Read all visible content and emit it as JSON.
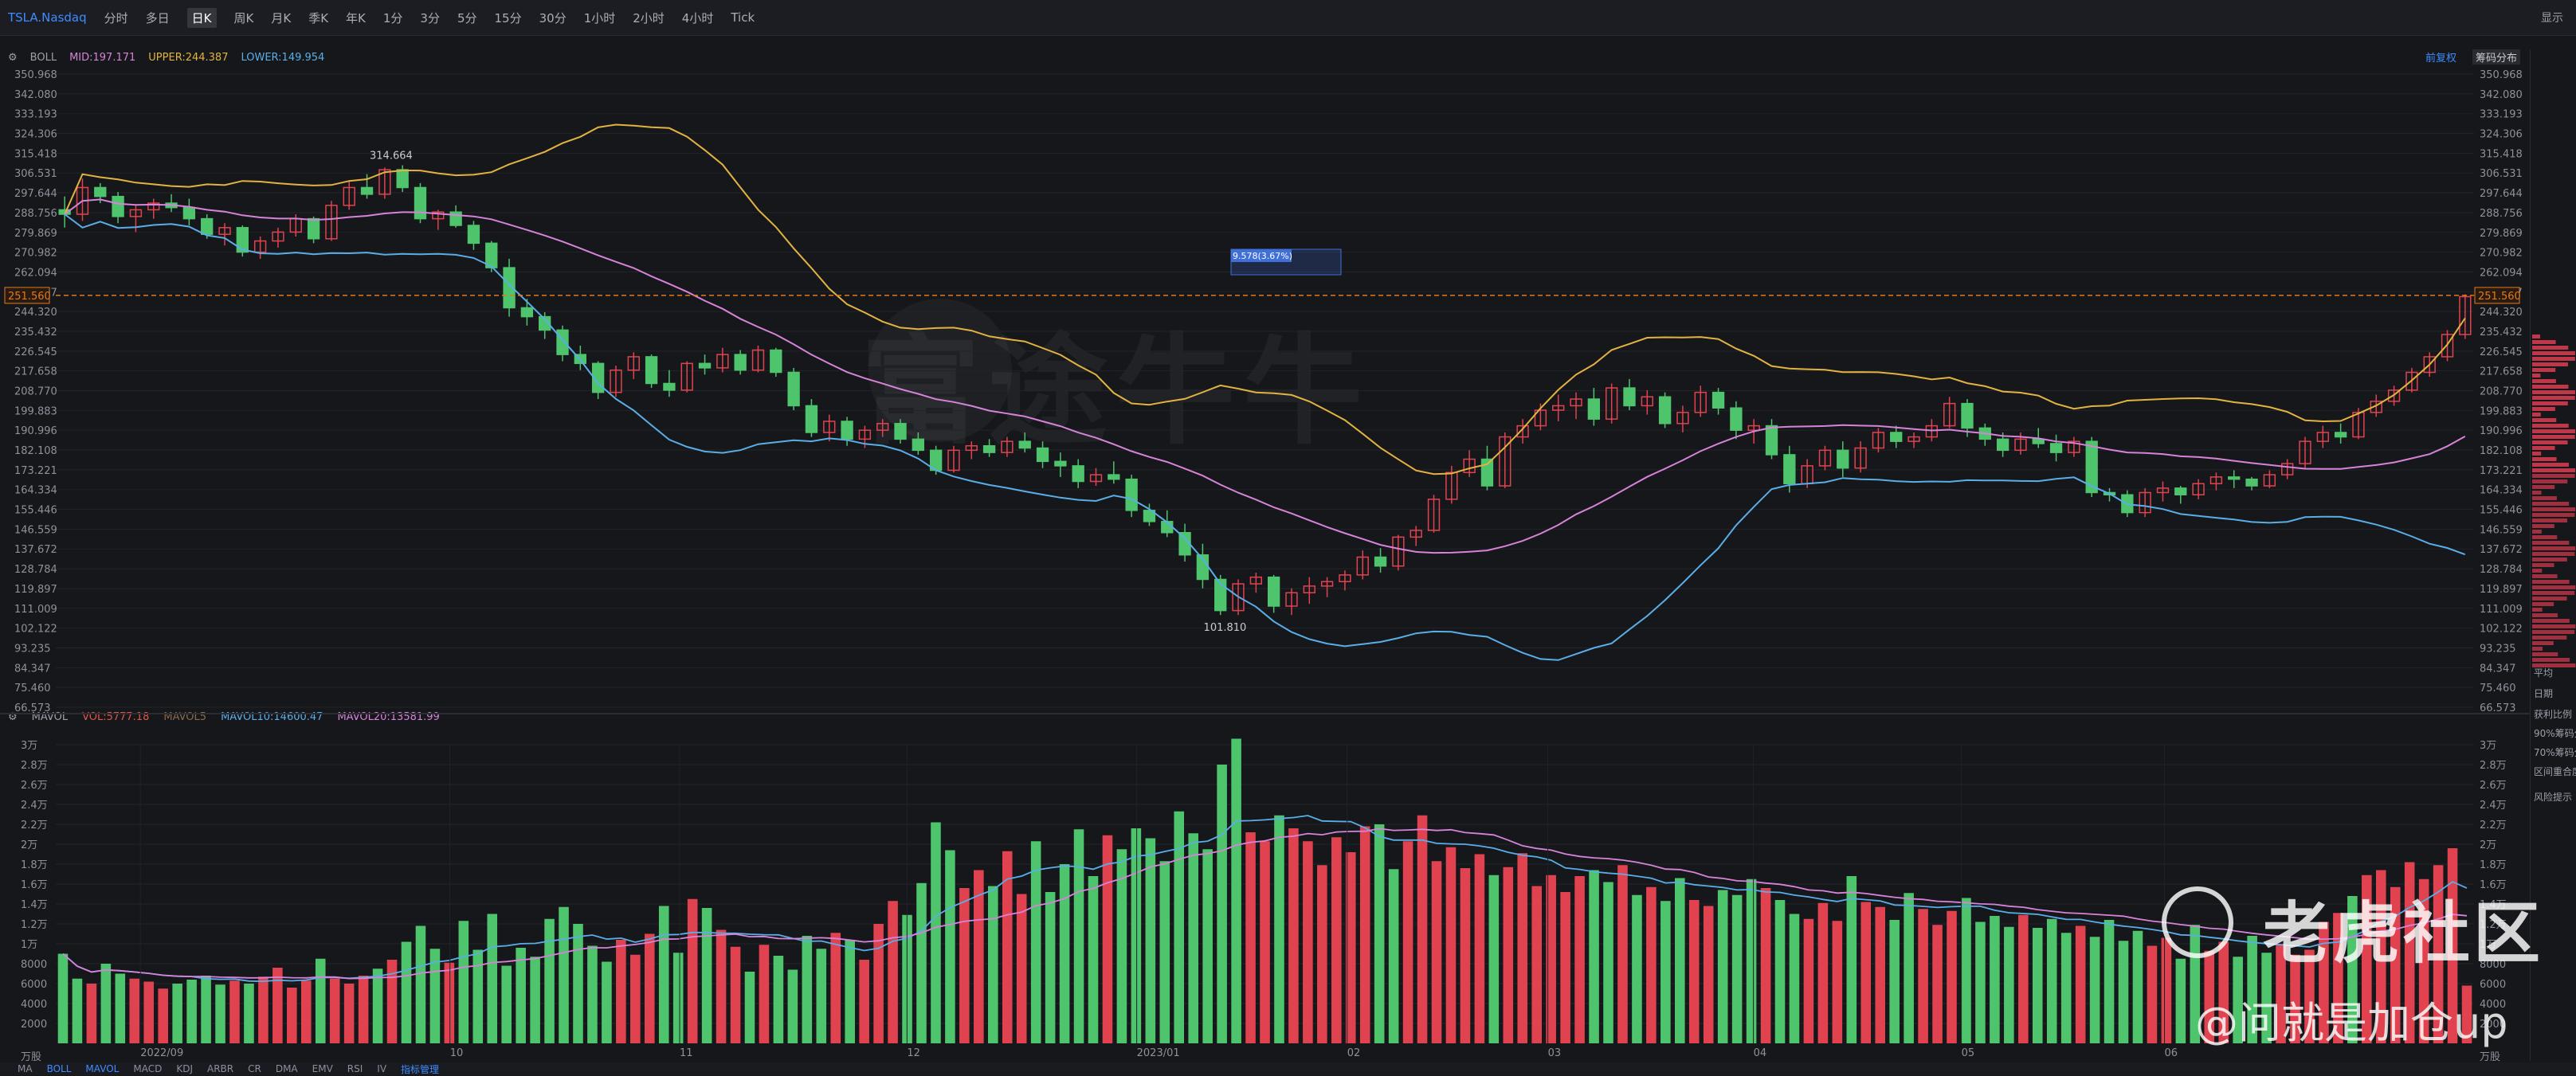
{
  "toolbar": {
    "symbol": "TSLA.Nasdaq",
    "timeframes": [
      "分时",
      "多日",
      "日K",
      "周K",
      "月K",
      "季K",
      "年K",
      "1分",
      "3分",
      "5分",
      "15分",
      "30分",
      "1小时",
      "2小时",
      "4小时",
      "Tick"
    ],
    "active_timeframe": "日K",
    "display_label": "显示"
  },
  "indicators": {
    "name": "BOLL",
    "mid": "MID:197.171",
    "upper": "UPPER:244.387",
    "lower": "LOWER:149.954",
    "adjust": "前复权",
    "chip": "筹码分布"
  },
  "volume_indicators": {
    "name": "MAVOL",
    "vol": "VOL:5777.18",
    "mavol5": "MAVOL5",
    "mavol10": "MAVOL10:14600.47",
    "mavol20": "MAVOL20:13581.99"
  },
  "colors": {
    "up": "#e0434f",
    "down": "#4ec46d",
    "mid": "#d683d9",
    "upper": "#e3b341",
    "lower": "#5aaee8",
    "bg": "#16171b",
    "last_price": "#e07a1f"
  },
  "price_axis_labels": [
    "350.968",
    "342.080",
    "333.193",
    "324.306",
    "315.418",
    "306.531",
    "297.644",
    "288.756",
    "279.869",
    "270.982",
    "262.094",
    "253.207",
    "244.320",
    "235.432",
    "226.545",
    "217.658",
    "208.770",
    "199.883",
    "190.996",
    "182.108",
    "173.221",
    "164.334",
    "155.446",
    "146.559",
    "137.672",
    "128.784",
    "119.897",
    "111.009",
    "102.122",
    "93.235",
    "84.347",
    "75.460",
    "66.573"
  ],
  "last_price_label": "251.560",
  "volume_axis_labels": [
    "3万",
    "2.8万",
    "2.6万",
    "2.4万",
    "2.2万",
    "2万",
    "1.8万",
    "1.6万",
    "1.4万",
    "1.2万",
    "1万",
    "8000",
    "6000",
    "4000",
    "2000",
    "万股"
  ],
  "date_labels": [
    "2022/09",
    "10",
    "11",
    "12",
    "2023/01",
    "02",
    "03",
    "04",
    "05",
    "06"
  ],
  "annotations": {
    "high": "314.664",
    "low": "101.810",
    "measure": "9.578(3.67%)"
  },
  "bottom_tabs": [
    "MA",
    "BOLL",
    "MAVOL",
    "MACD",
    "KDJ",
    "ARBR",
    "CR",
    "DMA",
    "EMV",
    "RSI",
    "IV",
    "指标管理"
  ],
  "side_panel": [
    "平均",
    "日期",
    "获利比例",
    "90%筹码分",
    "70%筹码分",
    "区间重合度",
    "风险提示"
  ],
  "watermarks": {
    "brand": "老虎社区",
    "user": "@问就是加仓up",
    "ghost": "富途牛牛"
  },
  "chart_data": {
    "type": "candlestick",
    "ylim": [
      66.573,
      350.968
    ],
    "volume_ylim": [
      0,
      30000
    ],
    "candles": [
      [
        290,
        296,
        282,
        288
      ],
      [
        288,
        304,
        285,
        300
      ],
      [
        300,
        302,
        293,
        296
      ],
      [
        296,
        298,
        284,
        287
      ],
      [
        287,
        292,
        280,
        290
      ],
      [
        290,
        295,
        286,
        293
      ],
      [
        293,
        297,
        289,
        291
      ],
      [
        291,
        295,
        283,
        286
      ],
      [
        286,
        288,
        277,
        279
      ],
      [
        279,
        284,
        274,
        282
      ],
      [
        282,
        283,
        269,
        271
      ],
      [
        271,
        278,
        268,
        276
      ],
      [
        276,
        282,
        273,
        280
      ],
      [
        280,
        288,
        278,
        286
      ],
      [
        286,
        287,
        275,
        277
      ],
      [
        277,
        294,
        276,
        292
      ],
      [
        292,
        303,
        290,
        300
      ],
      [
        300,
        306,
        295,
        297
      ],
      [
        297,
        309,
        295,
        308
      ],
      [
        308,
        310,
        298,
        300
      ],
      [
        300,
        302,
        284,
        286
      ],
      [
        286,
        290,
        281,
        289
      ],
      [
        289,
        292,
        282,
        283
      ],
      [
        283,
        285,
        272,
        275
      ],
      [
        275,
        276,
        262,
        264
      ],
      [
        264,
        268,
        242,
        246
      ],
      [
        246,
        250,
        238,
        242
      ],
      [
        242,
        244,
        232,
        236
      ],
      [
        236,
        238,
        222,
        225
      ],
      [
        225,
        229,
        218,
        221
      ],
      [
        221,
        222,
        205,
        208
      ],
      [
        208,
        220,
        206,
        218
      ],
      [
        218,
        226,
        214,
        224
      ],
      [
        224,
        225,
        210,
        212
      ],
      [
        212,
        218,
        206,
        209
      ],
      [
        209,
        222,
        208,
        221
      ],
      [
        221,
        225,
        216,
        219
      ],
      [
        219,
        228,
        217,
        225
      ],
      [
        225,
        227,
        216,
        218
      ],
      [
        218,
        229,
        217,
        227
      ],
      [
        227,
        228,
        215,
        217
      ],
      [
        217,
        219,
        200,
        202
      ],
      [
        202,
        205,
        188,
        190
      ],
      [
        190,
        198,
        186,
        195
      ],
      [
        195,
        197,
        184,
        187
      ],
      [
        187,
        193,
        183,
        191
      ],
      [
        191,
        196,
        188,
        194
      ],
      [
        194,
        196,
        185,
        187
      ],
      [
        187,
        190,
        180,
        182
      ],
      [
        182,
        184,
        171,
        173
      ],
      [
        173,
        184,
        172,
        182
      ],
      [
        182,
        186,
        178,
        184
      ],
      [
        184,
        187,
        179,
        181
      ],
      [
        181,
        188,
        179,
        186
      ],
      [
        186,
        190,
        181,
        183
      ],
      [
        183,
        186,
        174,
        177
      ],
      [
        177,
        181,
        170,
        175
      ],
      [
        175,
        178,
        165,
        168
      ],
      [
        168,
        174,
        166,
        171
      ],
      [
        171,
        177,
        167,
        169
      ],
      [
        169,
        171,
        152,
        155
      ],
      [
        155,
        158,
        148,
        150
      ],
      [
        150,
        155,
        143,
        145
      ],
      [
        145,
        149,
        132,
        135
      ],
      [
        135,
        140,
        120,
        124
      ],
      [
        124,
        126,
        108,
        110
      ],
      [
        110,
        124,
        108,
        122
      ],
      [
        122,
        127,
        118,
        125
      ],
      [
        125,
        126,
        109,
        112
      ],
      [
        112,
        120,
        108,
        118
      ],
      [
        118,
        125,
        113,
        121
      ],
      [
        121,
        125,
        116,
        123
      ],
      [
        123,
        128,
        119,
        126
      ],
      [
        126,
        137,
        124,
        134
      ],
      [
        134,
        138,
        127,
        130
      ],
      [
        130,
        144,
        128,
        143
      ],
      [
        143,
        148,
        139,
        146
      ],
      [
        146,
        162,
        145,
        160
      ],
      [
        160,
        175,
        158,
        172
      ],
      [
        172,
        182,
        170,
        178
      ],
      [
        178,
        184,
        164,
        166
      ],
      [
        166,
        190,
        165,
        188
      ],
      [
        188,
        196,
        185,
        193
      ],
      [
        193,
        203,
        191,
        200
      ],
      [
        200,
        207,
        195,
        202
      ],
      [
        202,
        208,
        196,
        205
      ],
      [
        205,
        210,
        193,
        196
      ],
      [
        196,
        212,
        194,
        210
      ],
      [
        210,
        214,
        200,
        202
      ],
      [
        202,
        209,
        198,
        206
      ],
      [
        206,
        208,
        192,
        194
      ],
      [
        194,
        202,
        190,
        199
      ],
      [
        199,
        211,
        197,
        208
      ],
      [
        208,
        210,
        198,
        201
      ],
      [
        201,
        204,
        187,
        191
      ],
      [
        191,
        196,
        185,
        193
      ],
      [
        193,
        196,
        178,
        180
      ],
      [
        180,
        184,
        163,
        167
      ],
      [
        167,
        178,
        165,
        175
      ],
      [
        175,
        184,
        173,
        182
      ],
      [
        182,
        186,
        170,
        174
      ],
      [
        174,
        186,
        172,
        183
      ],
      [
        183,
        192,
        181,
        190
      ],
      [
        190,
        193,
        183,
        186
      ],
      [
        186,
        190,
        183,
        188
      ],
      [
        188,
        196,
        186,
        193
      ],
      [
        193,
        206,
        192,
        203
      ],
      [
        203,
        205,
        188,
        192
      ],
      [
        192,
        194,
        184,
        187
      ],
      [
        187,
        190,
        179,
        182
      ],
      [
        182,
        190,
        180,
        187
      ],
      [
        187,
        192,
        183,
        185
      ],
      [
        185,
        189,
        177,
        181
      ],
      [
        181,
        188,
        179,
        186
      ],
      [
        186,
        188,
        161,
        163
      ],
      [
        163,
        165,
        159,
        162
      ],
      [
        162,
        164,
        152,
        154
      ],
      [
        154,
        165,
        152,
        163
      ],
      [
        163,
        168,
        159,
        165
      ],
      [
        165,
        166,
        158,
        162
      ],
      [
        162,
        169,
        160,
        167
      ],
      [
        167,
        172,
        164,
        170
      ],
      [
        170,
        173,
        165,
        169
      ],
      [
        169,
        170,
        164,
        166
      ],
      [
        166,
        173,
        165,
        171
      ],
      [
        171,
        178,
        169,
        176
      ],
      [
        176,
        188,
        174,
        186
      ],
      [
        186,
        193,
        183,
        190
      ],
      [
        190,
        194,
        185,
        188
      ],
      [
        188,
        201,
        187,
        199
      ],
      [
        199,
        207,
        197,
        204
      ],
      [
        204,
        211,
        202,
        209
      ],
      [
        209,
        219,
        208,
        217
      ],
      [
        217,
        226,
        215,
        224
      ],
      [
        224,
        236,
        222,
        234
      ],
      [
        234,
        252,
        232,
        251
      ]
    ],
    "volumes_k": [
      9,
      6.5,
      6,
      8,
      7,
      6.5,
      6.2,
      5.5,
      6,
      6.4,
      6.8,
      5.9,
      6.3,
      6,
      6.7,
      7.6,
      5.6,
      6.3,
      8.5,
      6.5,
      6,
      6.8,
      7.5,
      8.4,
      10.2,
      11.8,
      9.5,
      8.1,
      12.3,
      9.4,
      13,
      7.8,
      9.6,
      8.7,
      12.5,
      13.7,
      12,
      9.8,
      8.2,
      10.4,
      8.9,
      11,
      13.8,
      9.1,
      14.5,
      13.6,
      11.4,
      9.7,
      7.2,
      9.9,
      8.8,
      7.4,
      10.8,
      9.5,
      11.1,
      10.4,
      8.4,
      12,
      14.3,
      12.9,
      16.1,
      22.2,
      19.4,
      15.6,
      17.4,
      15.8,
      19.3,
      15,
      20.3,
      15.2,
      18,
      21.5,
      16.8,
      20.9,
      19.5,
      21.6,
      20.6,
      18.3,
      23.3,
      21.1,
      19.5,
      28,
      30.6,
      21.2,
      20.3,
      22.9,
      21.6,
      20.3,
      17.9,
      20.7,
      19.2,
      21.8,
      22,
      17.5,
      20.3,
      22.9,
      18.3,
      19.7,
      17.6,
      19,
      16.9,
      17.7,
      19.1,
      15.8,
      16.9,
      15.2,
      16.8,
      17.4,
      16.2,
      17.9,
      14.9,
      15.7,
      14.3,
      16.6,
      14.4,
      13.8,
      15.4,
      14.9,
      16.5,
      15.6,
      14.4,
      13,
      12.5,
      14.1,
      12.3,
      16.8,
      14.2,
      13.7,
      12.4,
      15.1,
      13.5,
      11.9,
      13.3,
      14.6,
      12.2,
      12.8,
      11.7,
      12.9,
      11.6,
      12.5,
      11.1,
      11.8,
      10.7,
      12.4,
      10.3,
      11.3,
      9.8,
      10.6,
      8.5,
      11.9,
      9.3,
      10.2,
      8.7,
      10.8,
      9.1,
      10,
      8.9,
      9.4,
      12.2,
      13.1,
      14.8,
      16.9,
      17.4,
      15.7,
      18.2,
      16.5,
      17.9,
      19.6,
      5.8
    ]
  }
}
